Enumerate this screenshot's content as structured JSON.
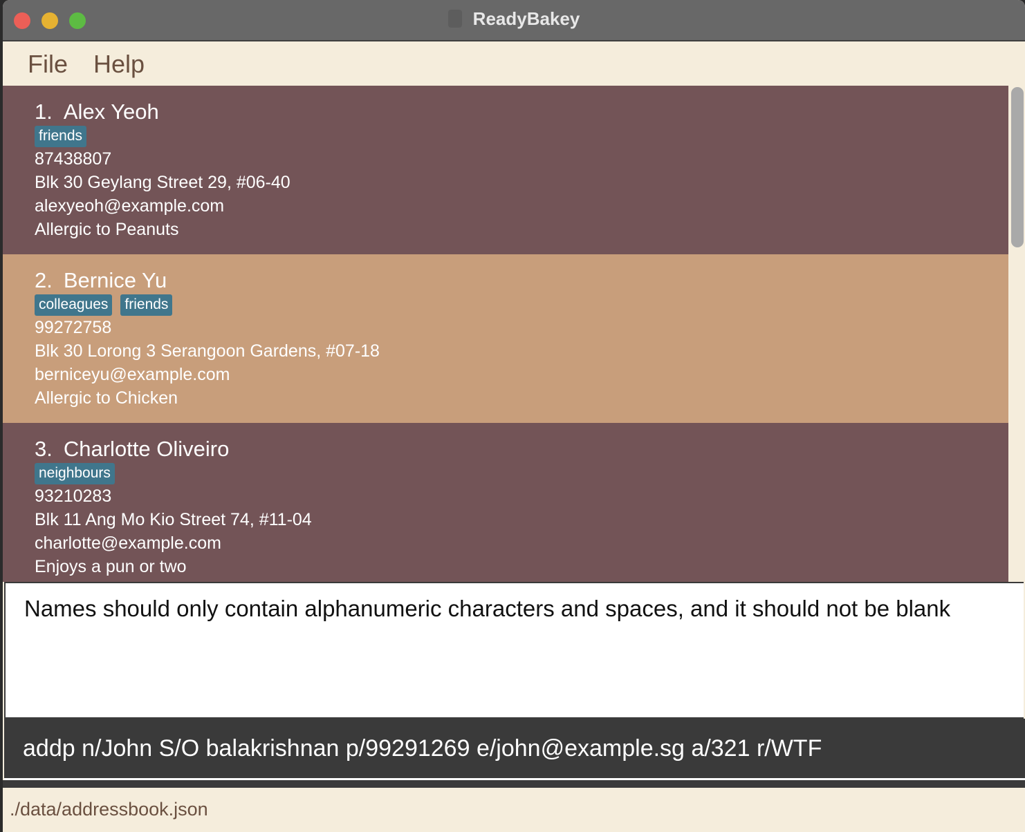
{
  "window": {
    "title": "ReadyBakey"
  },
  "menu": {
    "file": "File",
    "help": "Help"
  },
  "persons": [
    {
      "index": "1.",
      "name": "Alex Yeoh",
      "tags": [
        "friends"
      ],
      "phone": "87438807",
      "address": "Blk 30 Geylang Street 29, #06-40",
      "email": "alexyeoh@example.com",
      "remark": "Allergic to Peanuts"
    },
    {
      "index": "2.",
      "name": "Bernice Yu",
      "tags": [
        "colleagues",
        "friends"
      ],
      "phone": "99272758",
      "address": "Blk 30 Lorong 3 Serangoon Gardens, #07-18",
      "email": "berniceyu@example.com",
      "remark": "Allergic to Chicken"
    },
    {
      "index": "3.",
      "name": "Charlotte Oliveiro",
      "tags": [
        "neighbours"
      ],
      "phone": "93210283",
      "address": "Blk 11 Ang Mo Kio Street 74, #11-04",
      "email": "charlotte@example.com",
      "remark": "Enjoys a pun or two"
    }
  ],
  "result": {
    "message": "Names should only contain alphanumeric characters and spaces, and it should not be blank"
  },
  "command": {
    "value": "addp n/John S/O balakrishnan p/99291269 e/john@example.sg a/321 r/WTF"
  },
  "status": {
    "path": "./data/addressbook.json"
  },
  "colors": {
    "card_dark": "#735457",
    "card_light": "#c89e7b",
    "tag": "#40768c",
    "menu_text": "#6a5040"
  }
}
